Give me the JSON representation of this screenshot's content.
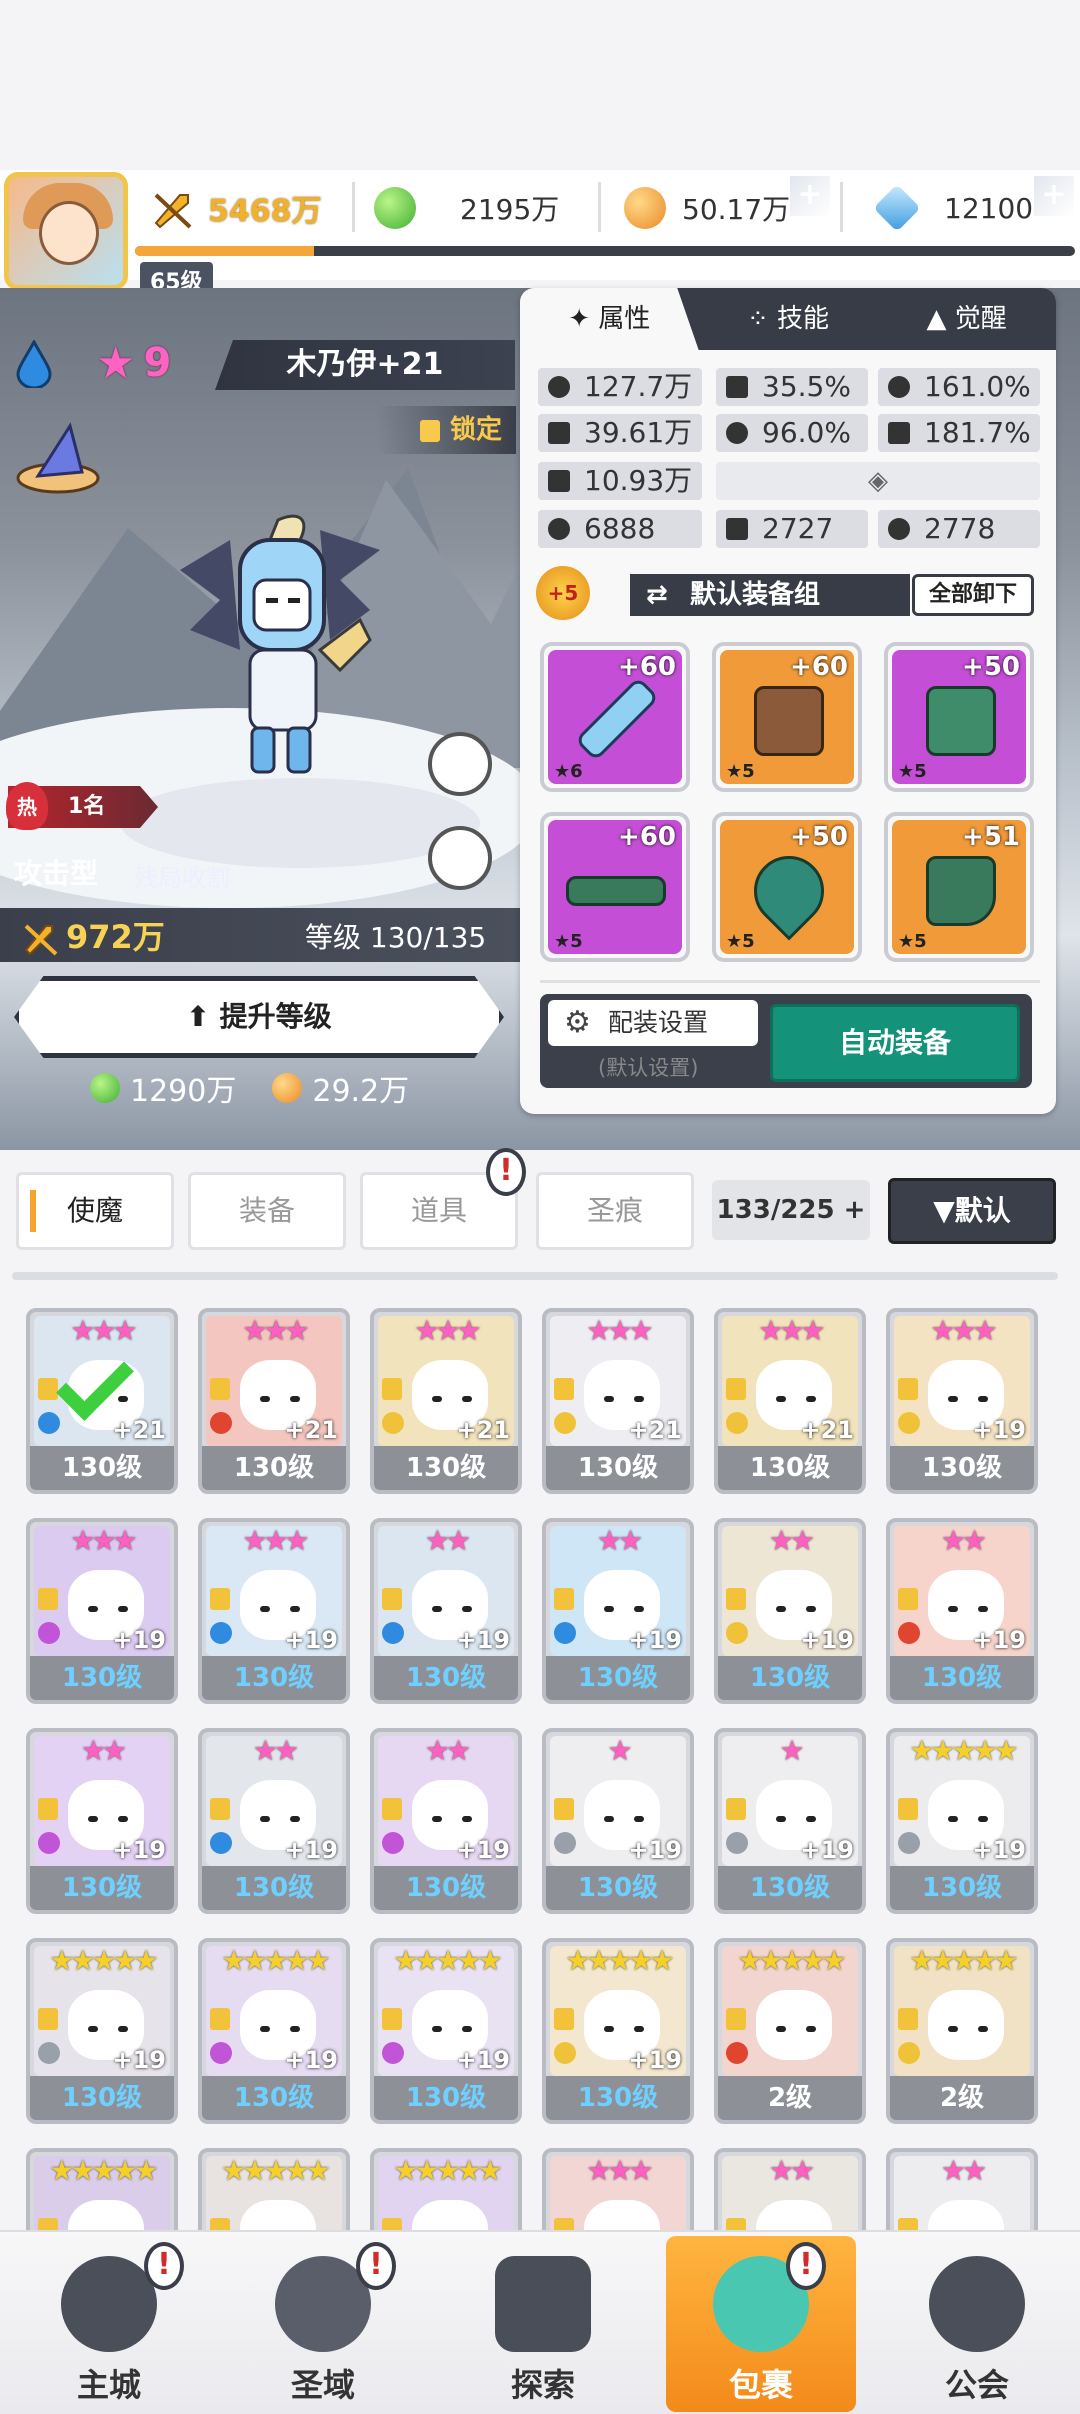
{
  "player": {
    "level": "65级",
    "xp_fraction": 0.19
  },
  "resources": {
    "power": "5468万",
    "gems": "2195万",
    "gold": "50.17万",
    "crystal": "12100"
  },
  "hero": {
    "stars": "9",
    "name": "木乃伊+21",
    "lock_label": "锁定",
    "rank_label": "热",
    "rank": "1名",
    "type": "攻击型",
    "skill_tag": "残局收割",
    "power": "972万",
    "level": "等级 130/135",
    "levelup_label": "提升等级",
    "cost_gems": "1290万",
    "cost_gold": "29.2万"
  },
  "detail_tabs": [
    {
      "label": "属性"
    },
    {
      "label": "技能"
    },
    {
      "label": "觉醒"
    }
  ],
  "stats": [
    {
      "icon": "heart-icon",
      "value": "127.7万"
    },
    {
      "icon": "burst-icon",
      "value": "35.5%"
    },
    {
      "icon": "sun-icon",
      "value": "161.0%"
    },
    {
      "icon": "dagger-icon",
      "value": "39.61万"
    },
    {
      "icon": "target-icon",
      "value": "96.0%"
    },
    {
      "icon": "slash-icon",
      "value": "181.7%"
    },
    {
      "icon": "shield-icon",
      "value": "10.93万"
    },
    {
      "icon": "swirl-icon",
      "value": "6888"
    },
    {
      "icon": "dash-icon",
      "value": "2727"
    },
    {
      "icon": "spiral-icon",
      "value": "2778"
    }
  ],
  "equip": {
    "badge": "+5",
    "set_name": "默认装备组",
    "unequip_all": "全部卸下",
    "items": [
      {
        "plus": "+60",
        "star": "★6",
        "color": "#c44fd6"
      },
      {
        "plus": "+60",
        "star": "★5",
        "color": "#f19a3a"
      },
      {
        "plus": "+50",
        "star": "★5",
        "color": "#c44fd6"
      },
      {
        "plus": "+60",
        "star": "★5",
        "color": "#c44fd6"
      },
      {
        "plus": "+50",
        "star": "★5",
        "color": "#f19a3a"
      },
      {
        "plus": "+51",
        "star": "★5",
        "color": "#f19a3a"
      }
    ],
    "config_label": "配装设置",
    "config_sub": "(默认设置)",
    "auto_label": "自动装备"
  },
  "filter": {
    "tabs": [
      {
        "label": "使魔"
      },
      {
        "label": "装备"
      },
      {
        "label": "道具"
      },
      {
        "label": "圣痕"
      }
    ],
    "count": "133/225",
    "sort": "▼默认"
  },
  "roster": [
    {
      "stars": "★★★",
      "plus": "+21",
      "level": "130级",
      "bg": "#dbe6f0"
    },
    {
      "stars": "★★★",
      "plus": "+21",
      "level": "130级",
      "bg": "#f4c6c0"
    },
    {
      "stars": "★★★",
      "plus": "+21",
      "level": "130级",
      "bg": "#f1e3bb"
    },
    {
      "stars": "★★★",
      "plus": "+21",
      "level": "130级",
      "bg": "#eeeef2"
    },
    {
      "stars": "★★★",
      "plus": "+21",
      "level": "130级",
      "bg": "#f1e3bb"
    },
    {
      "stars": "★★★",
      "plus": "+19",
      "level": "130级",
      "bg": "#f4e3c2"
    },
    {
      "stars": "★★★",
      "plus": "+19",
      "level": "130级",
      "bg": "#dccbf0"
    },
    {
      "stars": "★★★",
      "plus": "+19",
      "level": "130级",
      "bg": "#d9e8f4"
    },
    {
      "stars": "★★",
      "plus": "+19",
      "level": "130级",
      "bg": "#dbe6f0"
    },
    {
      "stars": "★★",
      "plus": "+19",
      "level": "130级",
      "bg": "#cfe6f6"
    },
    {
      "stars": "★★",
      "plus": "+19",
      "level": "130级",
      "bg": "#eee6d5"
    },
    {
      "stars": "★★",
      "plus": "+19",
      "level": "130级",
      "bg": "#f6d4cc"
    },
    {
      "stars": "★★",
      "plus": "+19",
      "level": "130级",
      "bg": "#e3d2f4"
    },
    {
      "stars": "★★",
      "plus": "+19",
      "level": "130级",
      "bg": "#e3e6ea"
    },
    {
      "stars": "★★",
      "plus": "+19",
      "level": "130级",
      "bg": "#e6d8f2"
    },
    {
      "stars": "★",
      "plus": "+19",
      "level": "130级",
      "bg": "#eeeef0"
    },
    {
      "stars": "★",
      "plus": "+19",
      "level": "130级",
      "bg": "#eeeef0"
    },
    {
      "stars": "★★★★★",
      "plus": "+19",
      "level": "130级",
      "bg": "#ececef"
    },
    {
      "stars": "★★★★★",
      "plus": "+19",
      "level": "130级",
      "bg": "#e6e3ea"
    },
    {
      "stars": "★★★★★",
      "plus": "+19",
      "level": "130级",
      "bg": "#e6dcf2"
    },
    {
      "stars": "★★★★★",
      "plus": "+19",
      "level": "130级",
      "bg": "#e9e2f3"
    },
    {
      "stars": "★★★★★",
      "plus": "+19",
      "level": "130级",
      "bg": "#f3e8cf"
    },
    {
      "stars": "★★★★★",
      "plus": "",
      "level": "2级",
      "bg": "#f3d5cf"
    },
    {
      "stars": "★★★★★",
      "plus": "",
      "level": "2级",
      "bg": "#f1e2c6"
    },
    {
      "stars": "★★★★★",
      "plus": "",
      "level": "",
      "bg": "#d9cde9"
    },
    {
      "stars": "★★★★★",
      "plus": "",
      "level": "",
      "bg": "#e8e3e0"
    },
    {
      "stars": "★★★★★",
      "plus": "",
      "level": "",
      "bg": "#e0d4f0"
    },
    {
      "stars": "★★★",
      "plus": "",
      "level": "",
      "bg": "#f1d6d3"
    },
    {
      "stars": "★★",
      "plus": "",
      "level": "",
      "bg": "#eae6e0"
    },
    {
      "stars": "★★",
      "plus": "",
      "level": "",
      "bg": "#ededf0"
    }
  ],
  "nav": [
    {
      "label": "主城",
      "badge": "!"
    },
    {
      "label": "圣域",
      "badge": "!"
    },
    {
      "label": "探索",
      "badge": ""
    },
    {
      "label": "包裹",
      "badge": "!"
    },
    {
      "label": "公会",
      "badge": ""
    }
  ],
  "colors": {
    "accent": "#f3a52e",
    "teal": "#14937a",
    "dark": "#383c46"
  }
}
